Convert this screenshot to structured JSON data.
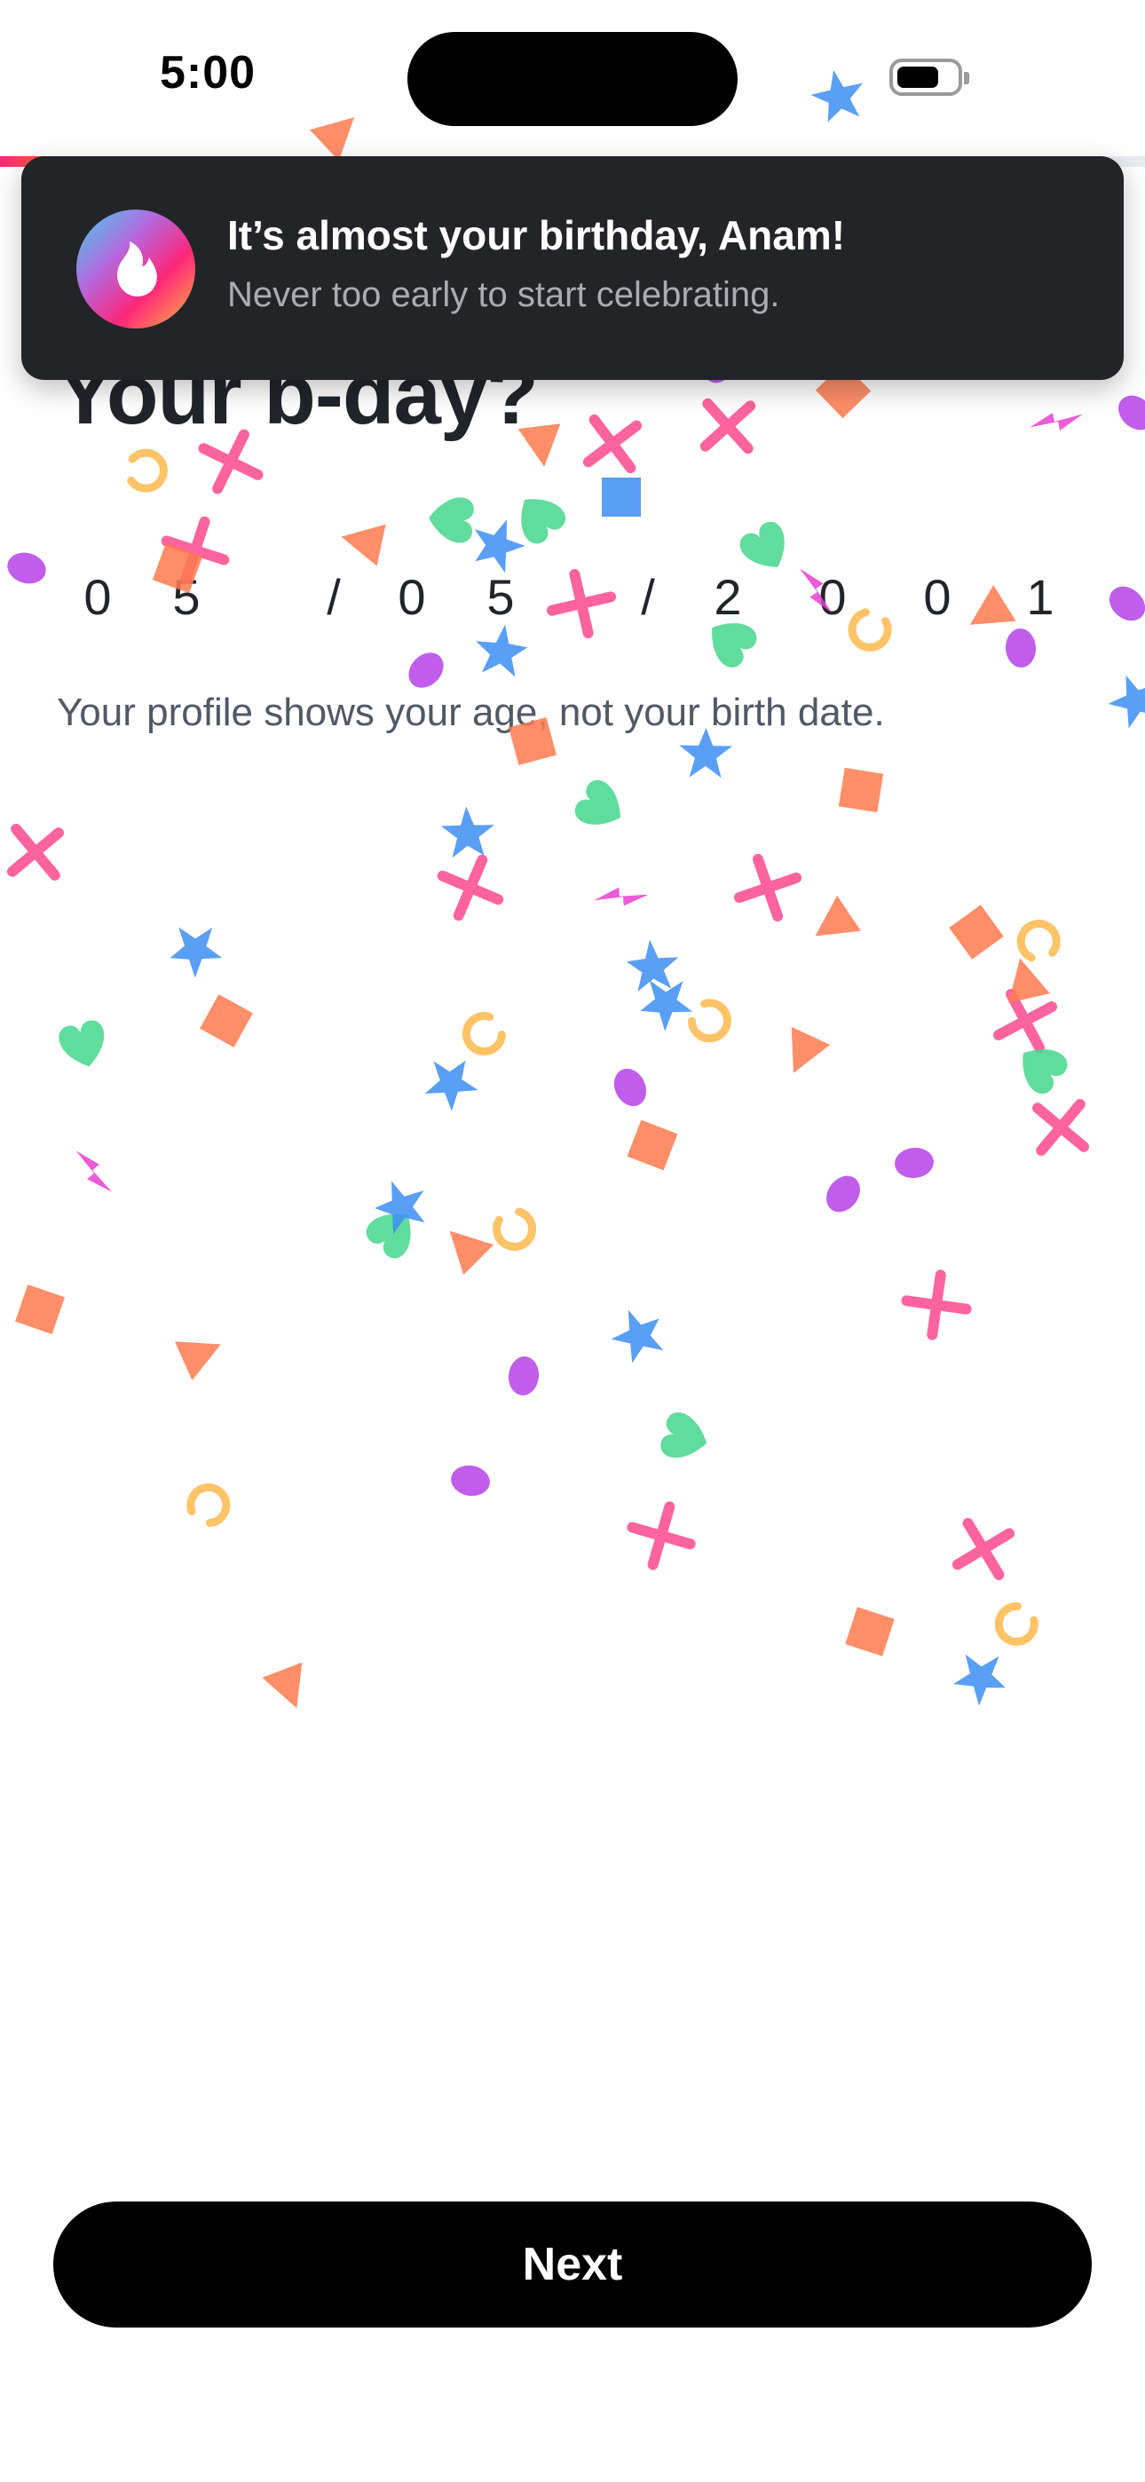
{
  "status_bar": {
    "time": "5:00"
  },
  "signup": {
    "progress_fraction": 0.04,
    "title": "Your b-day?",
    "birthdate_chars": [
      "0",
      "5",
      "/",
      "0",
      "5",
      "/",
      "2",
      "0",
      "0",
      "1"
    ],
    "helper_text": "Your profile shows your age, not your birth date.",
    "next_label": "Next"
  },
  "notification": {
    "title": "It’s almost your birthday, Anam!",
    "body": "Never too early to start celebrating."
  },
  "colors": {
    "brand_gradient": [
      "#fd267a",
      "#ff6036"
    ],
    "confetti": [
      "#fd4a8c",
      "#3d8ef5",
      "#44d68c",
      "#ff7a4f",
      "#b542e8",
      "#ffb84d",
      "#e83fd0"
    ]
  }
}
